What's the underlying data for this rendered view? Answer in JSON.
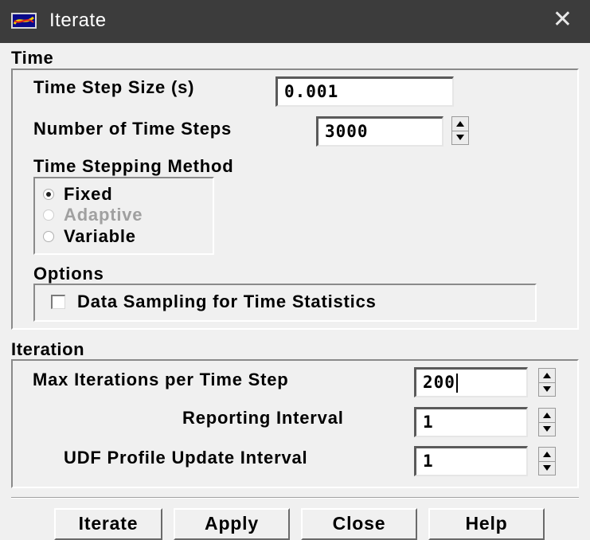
{
  "window": {
    "title": "Iterate",
    "close_icon": "close-icon",
    "app_icon": "fluent-app-icon"
  },
  "time": {
    "section_label": "Time",
    "step_size_label": "Time Step Size (s)",
    "step_size_value": "0.001",
    "num_steps_label": "Number of Time Steps",
    "num_steps_value": "3000",
    "method_label": "Time Stepping Method",
    "methods": [
      {
        "label": "Fixed",
        "checked": true,
        "disabled": false
      },
      {
        "label": "Adaptive",
        "checked": false,
        "disabled": true
      },
      {
        "label": "Variable",
        "checked": false,
        "disabled": false
      }
    ],
    "options_label": "Options",
    "sampling_label": "Data Sampling for Time Statistics",
    "sampling_checked": false
  },
  "iteration": {
    "section_label": "Iteration",
    "max_iter_label": "Max Iterations per Time Step",
    "max_iter_value": "200",
    "reporting_label": "Reporting Interval",
    "reporting_value": "1",
    "udf_label": "UDF Profile Update Interval",
    "udf_value": "1"
  },
  "buttons": {
    "iterate": "Iterate",
    "apply": "Apply",
    "close": "Close",
    "help": "Help"
  }
}
